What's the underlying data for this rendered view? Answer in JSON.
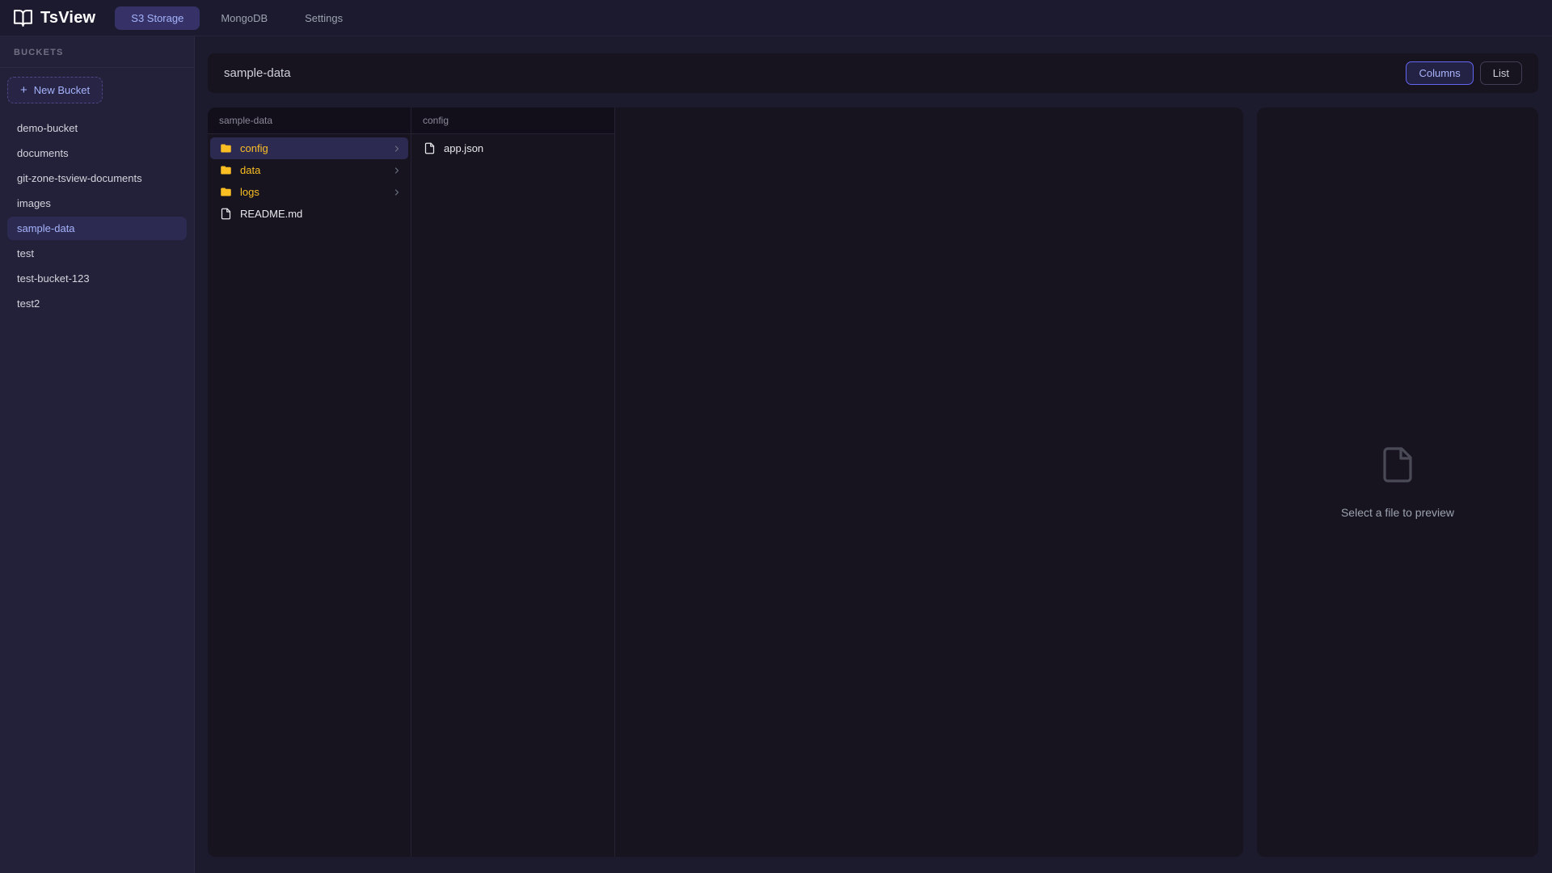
{
  "app": {
    "name": "TsView"
  },
  "nav": {
    "tabs": [
      {
        "label": "S3 Storage",
        "active": true
      },
      {
        "label": "MongoDB",
        "active": false
      },
      {
        "label": "Settings",
        "active": false
      }
    ]
  },
  "sidebar": {
    "heading": "BUCKETS",
    "new_bucket_label": "New Bucket",
    "buckets": [
      {
        "name": "demo-bucket",
        "selected": false
      },
      {
        "name": "documents",
        "selected": false
      },
      {
        "name": "git-zone-tsview-documents",
        "selected": false
      },
      {
        "name": "images",
        "selected": false
      },
      {
        "name": "sample-data",
        "selected": true
      },
      {
        "name": "test",
        "selected": false
      },
      {
        "name": "test-bucket-123",
        "selected": false
      },
      {
        "name": "test2",
        "selected": false
      }
    ]
  },
  "header": {
    "title": "sample-data",
    "view_toggle": [
      {
        "label": "Columns",
        "active": true
      },
      {
        "label": "List",
        "active": false
      }
    ]
  },
  "browser": {
    "columns": [
      {
        "header": "sample-data",
        "items": [
          {
            "name": "config",
            "type": "folder",
            "selected": true
          },
          {
            "name": "data",
            "type": "folder",
            "selected": false
          },
          {
            "name": "logs",
            "type": "folder",
            "selected": false
          },
          {
            "name": "README.md",
            "type": "file",
            "selected": false
          }
        ]
      },
      {
        "header": "config",
        "items": [
          {
            "name": "app.json",
            "type": "file",
            "selected": false
          }
        ]
      }
    ]
  },
  "preview": {
    "placeholder": "Select a file to preview"
  },
  "colors": {
    "accent": "#6366f1",
    "accent_text": "#a5b4fc",
    "folder": "#fbbf24",
    "page_bg": "#1c1a2d",
    "panel_bg": "#17141f",
    "sidebar_bg": "#232039",
    "topnav_bg": "#1b1a2e",
    "selection_bg": "#2d2a52"
  }
}
